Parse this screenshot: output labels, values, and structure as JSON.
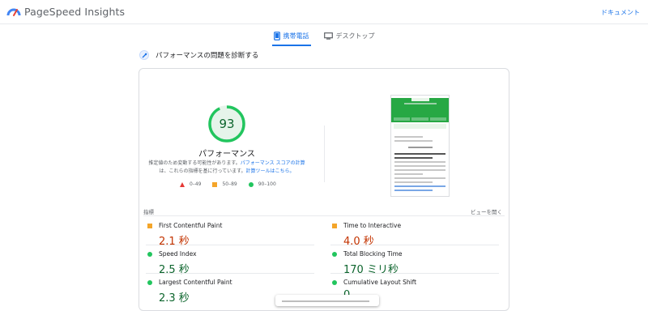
{
  "app": {
    "title": "PageSpeed Insights",
    "docs_link": "ドキュメント"
  },
  "tabs": [
    {
      "label": "携帯電話",
      "icon": "mobile-phone-icon",
      "active": true
    },
    {
      "label": "デスクトップ",
      "icon": "desktop-monitor-icon",
      "active": false
    }
  ],
  "section": {
    "title": "パフォーマンスの問題を診断する"
  },
  "performance": {
    "score": "93",
    "score_value": 93,
    "label": "パフォーマンス",
    "note_prefix": "推定値のため変動する可能性があります。",
    "note_link1": "パフォーマンス スコアの計算",
    "note_mid": "は、これらの指標を基に行っています。",
    "note_link2": "計算ツールはこちら。",
    "legend": [
      {
        "range": "0–49",
        "color": "#e53935"
      },
      {
        "range": "50–89",
        "color": "#f4a52a"
      },
      {
        "range": "90–100",
        "color": "#22c55e"
      }
    ],
    "gauge_color": "#22c55e"
  },
  "metrics_header": {
    "label": "指標",
    "expand": "ビューを開く"
  },
  "metrics": [
    {
      "name": "First Contentful Paint",
      "value": "2.1 秒",
      "status": "average"
    },
    {
      "name": "Time to Interactive",
      "value": "4.0 秒",
      "status": "average"
    },
    {
      "name": "Speed Index",
      "value": "2.5 秒",
      "status": "good"
    },
    {
      "name": "Total Blocking Time",
      "value": "170 ミリ秒",
      "status": "good"
    },
    {
      "name": "Largest Contentful Paint",
      "value": "2.3 秒",
      "status": "good"
    },
    {
      "name": "Cumulative Layout Shift",
      "value": "0",
      "status": "good"
    }
  ]
}
